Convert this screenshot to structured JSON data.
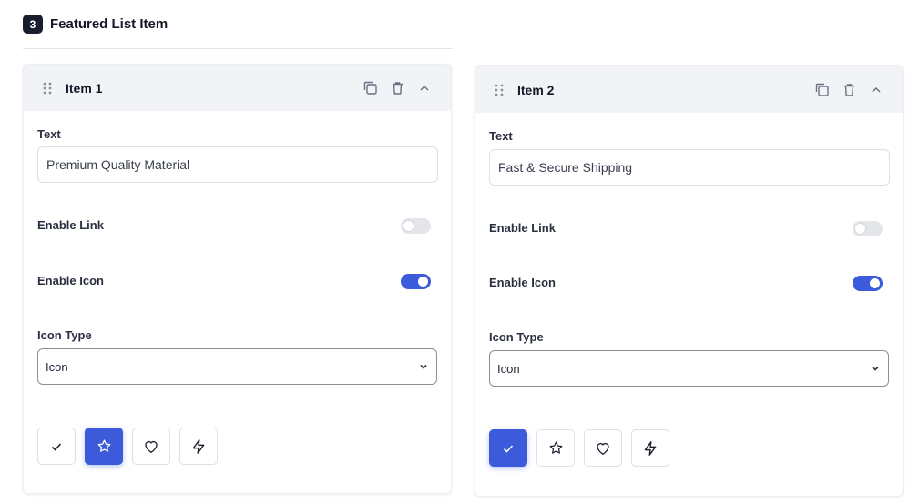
{
  "section": {
    "step": "3",
    "title": "Featured List Item"
  },
  "accent_color": "#3b5bdb",
  "items": [
    {
      "title": "Item 1",
      "text_label": "Text",
      "text_value": "Premium Quality Material",
      "enable_link_label": "Enable Link",
      "enable_link": false,
      "enable_icon_label": "Enable Icon",
      "enable_icon": true,
      "icon_type_label": "Icon Type",
      "icon_type_value": "Icon",
      "icon_options": [
        "check-icon",
        "star-icon",
        "heart-icon",
        "lightning-icon"
      ],
      "selected_icon": "star-icon"
    },
    {
      "title": "Item 2",
      "text_label": "Text",
      "text_value": "Fast & Secure Shipping",
      "enable_link_label": "Enable Link",
      "enable_link": false,
      "enable_icon_label": "Enable Icon",
      "enable_icon": true,
      "icon_type_label": "Icon Type",
      "icon_type_value": "Icon",
      "icon_options": [
        "check-icon",
        "star-icon",
        "heart-icon",
        "lightning-icon"
      ],
      "selected_icon": "check-icon"
    }
  ]
}
